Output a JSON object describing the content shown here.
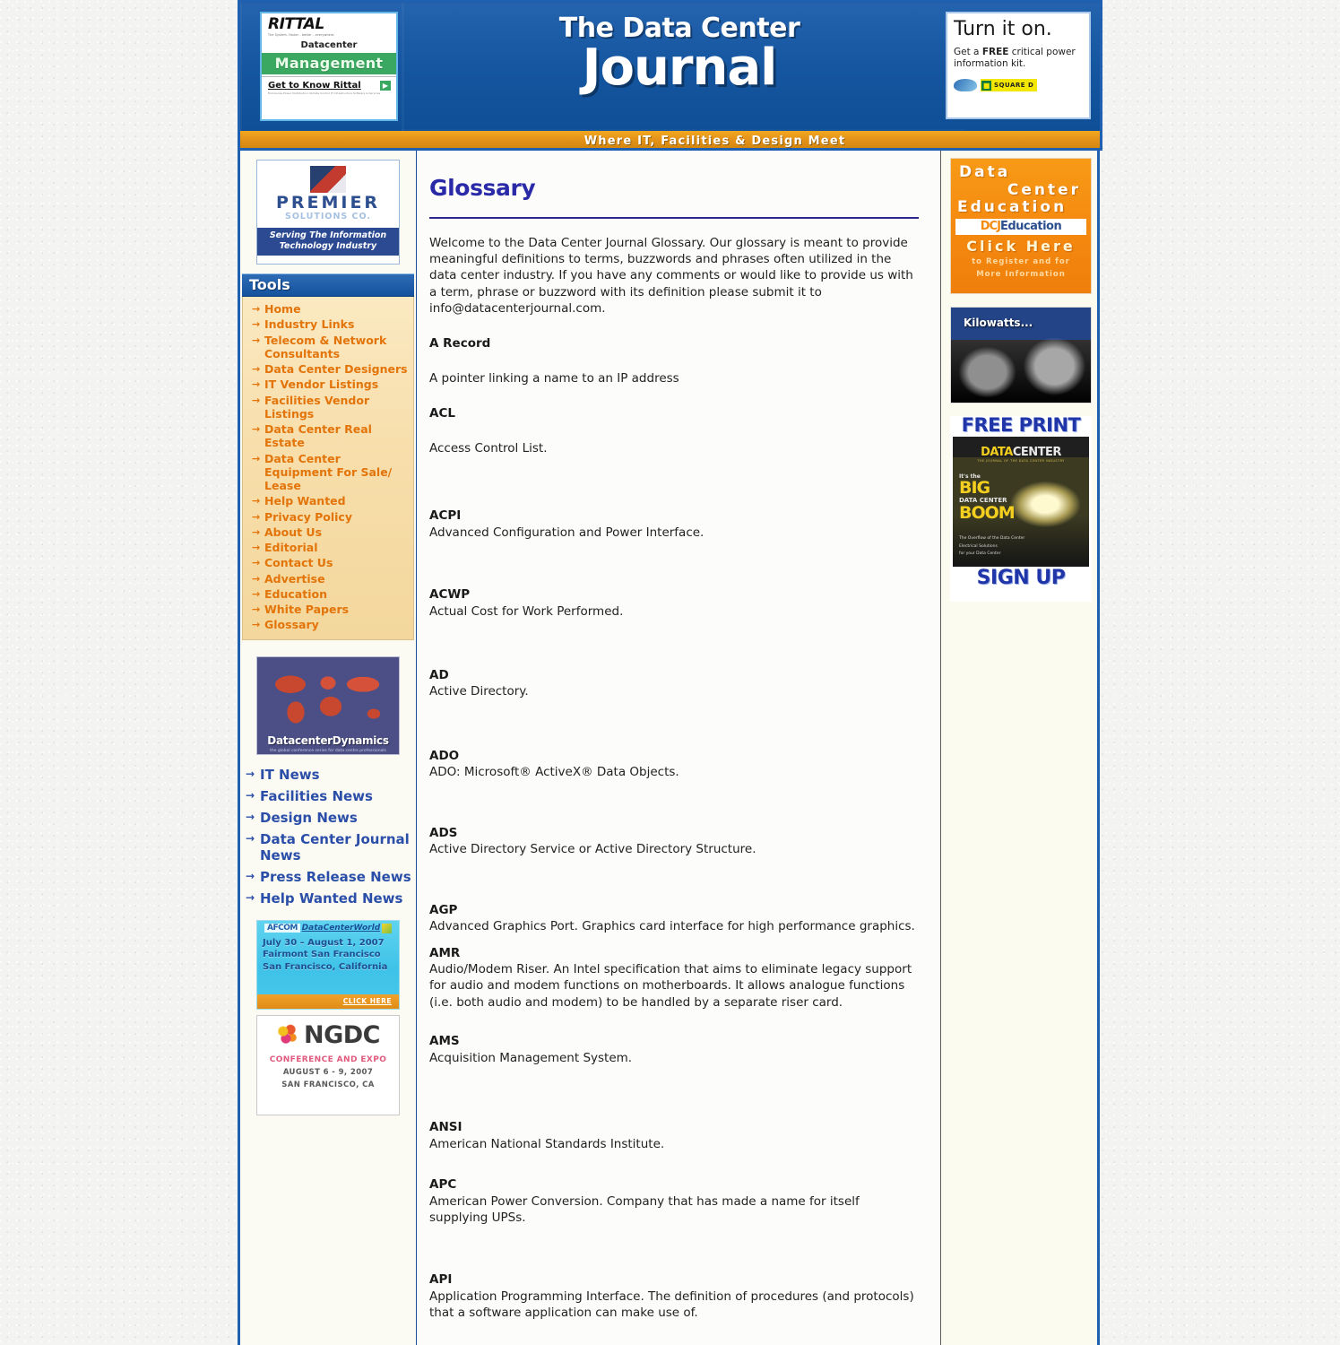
{
  "masthead": {
    "rittal_ad": {
      "logo": "RITTAL",
      "tiny_line": "The System. Faster - better - everywhere.",
      "line1": "Datacenter",
      "line2": "Management",
      "cta": "Get to Know Rittal",
      "cta_arrow": "▶",
      "footer_note": "Enclosures  Power Distribution  Climate Control  IT Infrastructure  Software & Services"
    },
    "title_line1": "The Data Center",
    "title_line2": "Journal",
    "tagline": "Where IT, Facilities & Design Meet",
    "turn_it_on_ad": {
      "headline": "Turn it on.",
      "body_pre": "Get a ",
      "body_bold": "FREE",
      "body_post": " critical power information kit.",
      "brand": "SQUARE D",
      "brand_glyph": "■"
    }
  },
  "left": {
    "premier_ad": {
      "name": "PREMIER",
      "sub": "SOLUTIONS CO.",
      "band_line1": "Serving The Information",
      "band_line2": "Technology Industry"
    },
    "tools_header": "Tools",
    "arrow_glyph": "→",
    "tools": [
      {
        "label": "Home"
      },
      {
        "label": "Industry Links"
      },
      {
        "label": "Telecom & Network Consultants"
      },
      {
        "label": "Data Center Designers"
      },
      {
        "label": "IT Vendor Listings"
      },
      {
        "label": "Facilities Vendor Listings"
      },
      {
        "label": "Data Center Real Estate"
      },
      {
        "label": "Data Center Equipment For Sale/ Lease"
      },
      {
        "label": "Help Wanted"
      },
      {
        "label": "Privacy Policy"
      },
      {
        "label": "About Us"
      },
      {
        "label": "Editorial"
      },
      {
        "label": "Contact Us"
      },
      {
        "label": "Advertise"
      },
      {
        "label": "Education"
      },
      {
        "label": "White Papers"
      },
      {
        "label": "Glossary"
      }
    ],
    "dcd_ad": {
      "label": "DatacenterDynamics",
      "tiny": "the global conference series for data centre professionals"
    },
    "news": [
      {
        "label": "IT News"
      },
      {
        "label": "Facilities News"
      },
      {
        "label": "Design News"
      },
      {
        "label": "Data Center Journal News"
      },
      {
        "label": "Press Release News"
      },
      {
        "label": "Help Wanted News"
      }
    ],
    "afcom_ad": {
      "brand1": "AFCOM",
      "brand2": "DataCenterWorld",
      "line1": "July 30 – August 1, 2007",
      "line2": "Fairmont San Francisco",
      "line3": "San Francisco, California",
      "cta": "CLICK HERE"
    },
    "ngdc_ad": {
      "name": "NGDC",
      "line1": "CONFERENCE AND EXPO",
      "line2": "AUGUST 6 - 9, 2007",
      "line3": "SAN FRANCISCO, CA"
    }
  },
  "main": {
    "title": "Glossary",
    "intro": "Welcome to the Data Center Journal Glossary. Our glossary is meant to provide meaningful definitions to terms, buzzwords and phrases often utilized in the data center industry. If you have any comments or would like to provide us with a term, phrase or buzzword with its definition please submit it to info@datacenterjournal.com.",
    "entries": [
      {
        "term": "A Record",
        "definition": "A pointer linking a name to an IP address",
        "spaced": true
      },
      {
        "term": "ACL",
        "definition": "Access Control List.",
        "spaced": true
      },
      {
        "term": "ACPI",
        "definition": "Advanced Configuration and Power Interface.",
        "spaced": false
      },
      {
        "term": "ACWP",
        "definition": "Actual Cost for Work Performed.",
        "spaced": false
      },
      {
        "term": "AD",
        "definition": "Active Directory.",
        "spaced": false
      },
      {
        "term": "ADO",
        "definition": "ADO: Microsoft® ActiveX® Data Objects.",
        "spaced": false
      },
      {
        "term": "ADS",
        "definition": "Active Directory Service or Active Directory Structure.",
        "spaced": false
      },
      {
        "term": "AGP",
        "definition": "Advanced Graphics Port. Graphics card interface for high performance graphics.",
        "spaced": false
      },
      {
        "term": "AMR",
        "definition": "Audio/Modem Riser. An Intel specification that aims to eliminate legacy support for audio and modem functions on motherboards. It allows analogue functions (i.e. both audio and modem) to be handled by a separate riser card.",
        "spaced": false
      },
      {
        "term": "AMS",
        "definition": "Acquisition Management System.",
        "spaced": false
      },
      {
        "term": "ANSI",
        "definition": "American National Standards Institute.",
        "spaced": false
      },
      {
        "term": "APC",
        "definition": "American Power Conversion. Company that has made a name for itself supplying UPSs.",
        "spaced": false
      },
      {
        "term": "API",
        "definition": "Application Programming Interface. The definition of procedures (and protocols) that a software application can make use of.",
        "spaced": false
      }
    ]
  },
  "right": {
    "education_ad": {
      "word1": "Data",
      "word2": "Center",
      "word3": "Education",
      "bar_left": "DCJ",
      "bar_right": "Education",
      "click": "Click Here",
      "small1": "to Register and for",
      "small2": "More Information"
    },
    "kilowatts_ad": {
      "caption": "Kilowatts..."
    },
    "freeprint_ad": {
      "top": "FREE PRINT",
      "cover_brand_1": "DATA",
      "cover_brand_2": "CENTER",
      "cover_sub": "THE JOURNAL OF THE DATA CENTER INDUSTRY",
      "cover_l1": "It's the",
      "cover_l2": "BIG",
      "cover_l3": "DATA CENTER",
      "cover_l4": "BOOM",
      "cover_foot1": "The Overflow of the Data Center",
      "cover_foot2": "Electrical Solutions",
      "cover_foot3": "for your Data Center",
      "bottom": "SIGN UP"
    }
  },
  "colors": {
    "header_blue": "#1a5aa8",
    "tagline_orange": "#e4931a",
    "tools_link_orange": "#e2740a",
    "news_link_blue": "#2b4fa8",
    "title_blue": "#2a2aa8",
    "sidebar_cream": "#f7deab",
    "page_bg": "#f3f3f1"
  }
}
